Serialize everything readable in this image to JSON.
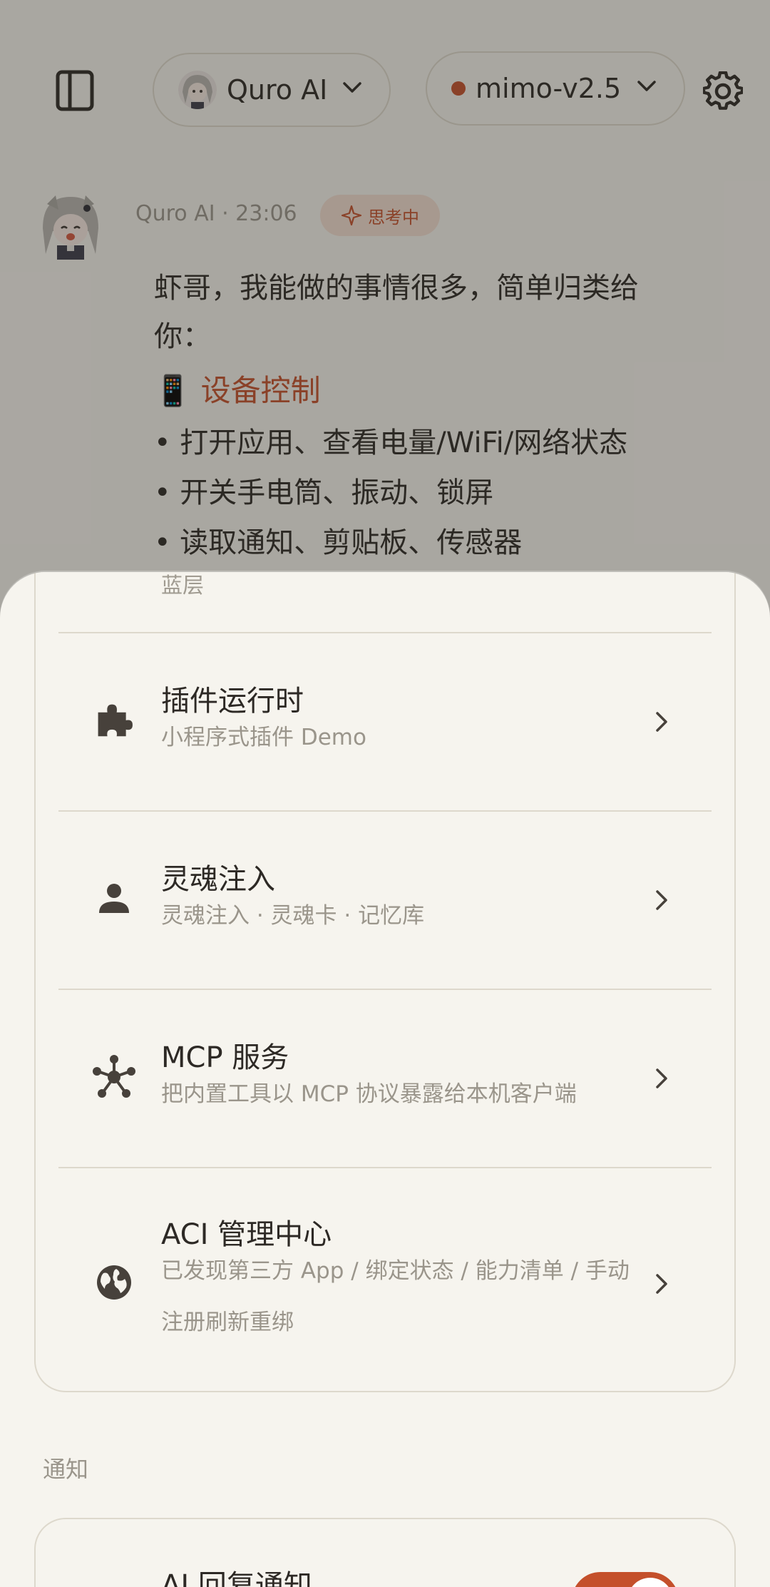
{
  "header": {
    "assistant_name": "Quro AI",
    "model_name": "mimo-v2.5"
  },
  "message": {
    "meta": "Quro AI · 23:06",
    "status_badge": "思考中",
    "intro": "虾哥，我能做的事情很多，简单归类给你：",
    "intro_line1": "虾哥，我能做的事情很多，简单归类给",
    "intro_line2": "你：",
    "section_emoji": "📱",
    "section_title": "设备控制",
    "bullets": [
      "• 打开应用、查看电量/WiFi/网络状态",
      "• 开关手电筒、振动、锁屏",
      "• 读取通知、剪贴板、传感器"
    ]
  },
  "sheet": {
    "partial_text": "蓝层",
    "items": [
      {
        "title": "插件运行时",
        "subtitle": "小程序式插件 Demo",
        "icon": "puzzle-icon"
      },
      {
        "title": "灵魂注入",
        "subtitle": "灵魂注入 · 灵魂卡 · 记忆库",
        "icon": "person-icon"
      },
      {
        "title": "MCP 服务",
        "subtitle": "把内置工具以 MCP 协议暴露给本机客户端",
        "icon": "hub-icon"
      },
      {
        "title": "ACI 管理中心",
        "subtitle": "已发现第三方 App / 绑定状态 / 能力清单 / 手动注册刷新重绑",
        "icon": "globe-icon"
      }
    ],
    "notifications_label": "通知",
    "notification_item": {
      "title": "AI 回复通知",
      "enabled": true
    }
  },
  "colors": {
    "accent": "#c4502b",
    "background": "#f6f4ee",
    "text": "#2d2925",
    "muted": "#9a958b",
    "divider": "#ddd8cc"
  }
}
